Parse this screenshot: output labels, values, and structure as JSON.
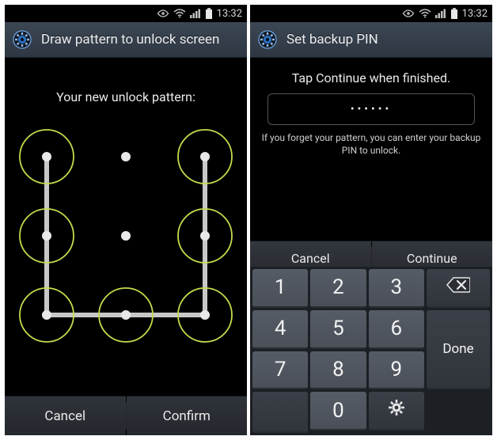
{
  "status": {
    "time": "13:32"
  },
  "left": {
    "header_title": "Draw pattern to unlock screen",
    "prompt": "Your new unlock pattern:",
    "cancel_label": "Cancel",
    "confirm_label": "Confirm",
    "pattern": {
      "grid": 3,
      "active_nodes": [
        0,
        2,
        3,
        5,
        6,
        7,
        8
      ],
      "stroke_sequence": [
        0,
        3,
        6,
        7,
        8,
        5,
        2
      ]
    }
  },
  "right": {
    "header_title": "Set backup PIN",
    "prompt": "Tap Continue when finished.",
    "pin_mask": "••••••",
    "hint": "If you forget your pattern, you can enter your backup PIN to unlock.",
    "cancel_label": "Cancel",
    "continue_label": "Continue",
    "keypad": {
      "k1": "1",
      "k2": "2",
      "k3": "3",
      "k4": "4",
      "k5": "5",
      "k6": "6",
      "k7": "7",
      "k8": "8",
      "k9": "9",
      "k0": "0",
      "done_label": "Done",
      "backspace_icon": "backspace-icon",
      "settings_icon": "gear-icon"
    }
  }
}
